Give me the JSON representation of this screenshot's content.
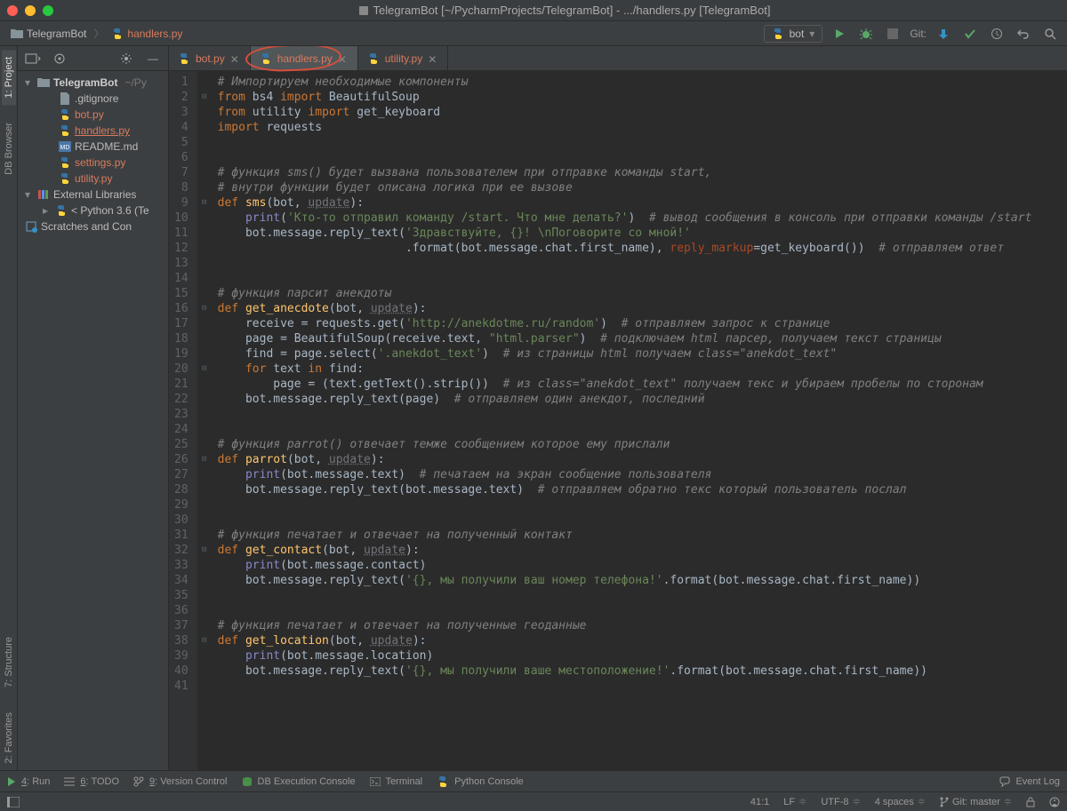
{
  "title": "TelegramBot [~/PycharmProjects/TelegramBot] - .../handlers.py [TelegramBot]",
  "breadcrumbs": {
    "project": "TelegramBot",
    "file": "handlers.py"
  },
  "run_config": "bot",
  "git_label": "Git:",
  "sidebar_tabs": {
    "project": "1: Project",
    "db": "DB Browser",
    "structure": "7: Structure",
    "favorites": "2: Favorites"
  },
  "tree": {
    "root": "TelegramBot",
    "root_path": "~/Py",
    "files": [
      ".gitignore",
      "bot.py",
      "handlers.py",
      "README.md",
      "settings.py",
      "utility.py"
    ],
    "external": "External Libraries",
    "python": "< Python 3.6 (Te",
    "scratches": "Scratches and Con"
  },
  "tabs": [
    "bot.py",
    "handlers.py",
    "utility.py"
  ],
  "active_tab": 1,
  "code_lines": [
    {
      "n": 1,
      "t": [
        [
          "com",
          "# Импортируем необходимые компоненты"
        ]
      ]
    },
    {
      "n": 2,
      "t": [
        [
          "kw",
          "from "
        ],
        [
          "id",
          "bs4 "
        ],
        [
          "kw",
          "import "
        ],
        [
          "id",
          "BeautifulSoup"
        ]
      ]
    },
    {
      "n": 3,
      "t": [
        [
          "kw",
          "from "
        ],
        [
          "id",
          "utility "
        ],
        [
          "kw",
          "import "
        ],
        [
          "id",
          "get_keyboard"
        ]
      ]
    },
    {
      "n": 4,
      "t": [
        [
          "kw",
          "import "
        ],
        [
          "id",
          "requests"
        ]
      ]
    },
    {
      "n": 5,
      "t": []
    },
    {
      "n": 6,
      "t": []
    },
    {
      "n": 7,
      "t": [
        [
          "com",
          "# функция sms() будет вызвана пользователем при отправке команды start,"
        ]
      ]
    },
    {
      "n": 8,
      "t": [
        [
          "com",
          "# внутри функции будет описана логика при ее вызове"
        ]
      ]
    },
    {
      "n": 9,
      "t": [
        [
          "kw",
          "def "
        ],
        [
          "fn",
          "sms"
        ],
        [
          "id",
          "(bot, "
        ],
        [
          "param",
          "update"
        ],
        [
          "id",
          "):"
        ]
      ]
    },
    {
      "n": 10,
      "t": [
        [
          "id",
          "    "
        ],
        [
          "builtin",
          "print"
        ],
        [
          "id",
          "("
        ],
        [
          "str",
          "'Кто-то отправил команду /start. Что мне делать?'"
        ],
        [
          "id",
          ")  "
        ],
        [
          "com",
          "# вывод сообщения в консоль при отправки команды /start"
        ]
      ]
    },
    {
      "n": 11,
      "t": [
        [
          "id",
          "    bot.message.reply_text("
        ],
        [
          "str",
          "'Здравствуйте, {}! \\nПоговорите со мной!'"
        ]
      ]
    },
    {
      "n": 12,
      "t": [
        [
          "id",
          "                           .format(bot.message.chat.first_name), "
        ],
        [
          "named",
          "reply_markup"
        ],
        [
          "id",
          "=get_keyboard())  "
        ],
        [
          "com",
          "# отправляем ответ"
        ]
      ]
    },
    {
      "n": 13,
      "t": []
    },
    {
      "n": 14,
      "t": []
    },
    {
      "n": 15,
      "t": [
        [
          "com",
          "# функция парсит анекдоты"
        ]
      ]
    },
    {
      "n": 16,
      "t": [
        [
          "kw",
          "def "
        ],
        [
          "fn",
          "get_anecdote"
        ],
        [
          "id",
          "(bot, "
        ],
        [
          "param",
          "update"
        ],
        [
          "id",
          "):"
        ]
      ]
    },
    {
      "n": 17,
      "t": [
        [
          "id",
          "    receive = requests.get("
        ],
        [
          "str",
          "'http://anekdotme.ru/random'"
        ],
        [
          "id",
          ")  "
        ],
        [
          "com",
          "# отправляем запрос к странице"
        ]
      ]
    },
    {
      "n": 18,
      "t": [
        [
          "id",
          "    page = BeautifulSoup(receive.text, "
        ],
        [
          "str",
          "\"html.parser\""
        ],
        [
          "id",
          ")  "
        ],
        [
          "com",
          "# подключаем html парсер, получаем текст страницы"
        ]
      ]
    },
    {
      "n": 19,
      "t": [
        [
          "id",
          "    find = page.select("
        ],
        [
          "str",
          "'.anekdot_text'"
        ],
        [
          "id",
          ")  "
        ],
        [
          "com",
          "# из страницы html получаем class=\"anekdot_text\""
        ]
      ]
    },
    {
      "n": 20,
      "t": [
        [
          "id",
          "    "
        ],
        [
          "kw",
          "for "
        ],
        [
          "id",
          "text "
        ],
        [
          "kw",
          "in "
        ],
        [
          "id",
          "find:"
        ]
      ]
    },
    {
      "n": 21,
      "t": [
        [
          "id",
          "        page = (text.getText().strip())  "
        ],
        [
          "com",
          "# из class=\"anekdot_text\" получаем текс и убираем пробелы по сторонам"
        ]
      ]
    },
    {
      "n": 22,
      "t": [
        [
          "id",
          "    bot.message.reply_text(page)  "
        ],
        [
          "com",
          "# отправляем один анекдот, последний"
        ]
      ]
    },
    {
      "n": 23,
      "t": []
    },
    {
      "n": 24,
      "t": []
    },
    {
      "n": 25,
      "t": [
        [
          "com",
          "# функция parrot() отвечает темже сообщением которое ему прислали"
        ]
      ]
    },
    {
      "n": 26,
      "t": [
        [
          "kw",
          "def "
        ],
        [
          "fn",
          "parrot"
        ],
        [
          "id",
          "(bot, "
        ],
        [
          "param",
          "update"
        ],
        [
          "id",
          "):"
        ]
      ]
    },
    {
      "n": 27,
      "t": [
        [
          "id",
          "    "
        ],
        [
          "builtin",
          "print"
        ],
        [
          "id",
          "(bot.message.text)  "
        ],
        [
          "com",
          "# печатаем на экран сообщение пользователя"
        ]
      ]
    },
    {
      "n": 28,
      "t": [
        [
          "id",
          "    bot.message.reply_text(bot.message.text)  "
        ],
        [
          "com",
          "# отправляем обратно текс который пользователь послал"
        ]
      ]
    },
    {
      "n": 29,
      "t": []
    },
    {
      "n": 30,
      "t": []
    },
    {
      "n": 31,
      "t": [
        [
          "com",
          "# функция печатает и отвечает на полученный контакт"
        ]
      ]
    },
    {
      "n": 32,
      "t": [
        [
          "kw",
          "def "
        ],
        [
          "fn",
          "get_contact"
        ],
        [
          "id",
          "(bot, "
        ],
        [
          "param",
          "update"
        ],
        [
          "id",
          "):"
        ]
      ]
    },
    {
      "n": 33,
      "t": [
        [
          "id",
          "    "
        ],
        [
          "builtin",
          "print"
        ],
        [
          "id",
          "(bot.message.contact)"
        ]
      ]
    },
    {
      "n": 34,
      "t": [
        [
          "id",
          "    bot.message.reply_text("
        ],
        [
          "str",
          "'{}, мы получили ваш номер телефона!'"
        ],
        [
          "id",
          ".format(bot.message.chat.first_name))"
        ]
      ]
    },
    {
      "n": 35,
      "t": []
    },
    {
      "n": 36,
      "t": []
    },
    {
      "n": 37,
      "t": [
        [
          "com",
          "# функция печатает и отвечает на полученные геоданные"
        ]
      ]
    },
    {
      "n": 38,
      "t": [
        [
          "kw",
          "def "
        ],
        [
          "fn",
          "get_location"
        ],
        [
          "id",
          "(bot, "
        ],
        [
          "param",
          "update"
        ],
        [
          "id",
          "):"
        ]
      ]
    },
    {
      "n": 39,
      "t": [
        [
          "id",
          "    "
        ],
        [
          "builtin",
          "print"
        ],
        [
          "id",
          "(bot.message.location)"
        ]
      ]
    },
    {
      "n": 40,
      "t": [
        [
          "id",
          "    bot.message.reply_text("
        ],
        [
          "str",
          "'{}, мы получили ваше местоположение!'"
        ],
        [
          "id",
          ".format(bot.message.chat.first_name))"
        ]
      ]
    },
    {
      "n": 41,
      "t": []
    }
  ],
  "bottom_tools": {
    "run": "4: Run",
    "todo": "6: TODO",
    "vcs": "9: Version Control",
    "db": "DB Execution Console",
    "terminal": "Terminal",
    "pyconsole": "Python Console",
    "eventlog": "Event Log"
  },
  "status": {
    "pos": "41:1",
    "lineend": "LF",
    "encoding": "UTF-8",
    "indent": "4 spaces",
    "git": "Git: master"
  }
}
